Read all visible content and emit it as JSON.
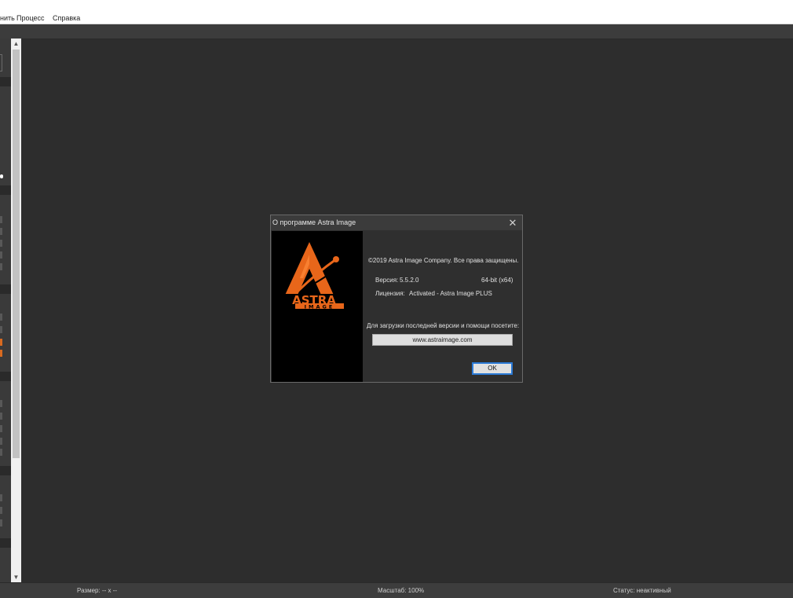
{
  "menu": {
    "items": [
      "нить",
      "Процесс",
      "Справка"
    ]
  },
  "status_bar": {
    "size": "Размер: -- x --",
    "zoom": "Масштаб: 100%",
    "status": "Статус: неактивный"
  },
  "dialog": {
    "title": "О программе Astra Image",
    "close_glyph": "✕",
    "logo": {
      "text_main": "ASTRA",
      "text_sub": "IMAGE",
      "accent_color": "#e8661a"
    },
    "copyright": "©2019 Astra Image Company. Все права защищены.",
    "version_label": "Версия:",
    "version_value": "5.5.2.0",
    "architecture": "64-bit (x64)",
    "license_label": "Лицензия:",
    "license_value": "Activated - Astra Image PLUS",
    "download_prompt": "Для загрузки последней версии и помощи посетите:",
    "website_button": "www.astraimage.com",
    "ok_button": "OK"
  },
  "scrollbar": {
    "up_glyph": "▲",
    "down_glyph": "▼"
  }
}
